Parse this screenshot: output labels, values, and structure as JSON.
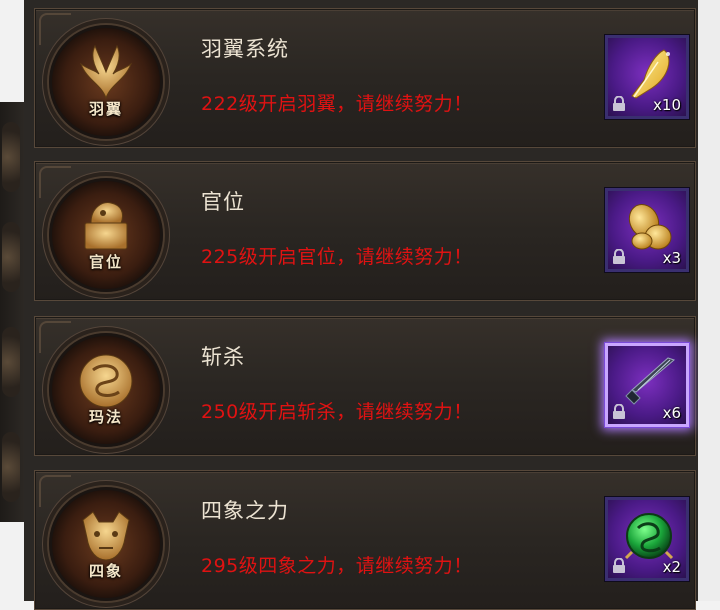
{
  "features": [
    {
      "title": "羽翼系统",
      "requirement": "222级开启羽翼，请继续努力！",
      "emblem_label": "羽翼",
      "emblem_icon": "wings-icon",
      "reward": {
        "icon": "golden-feather-icon",
        "count": "x10",
        "locked": true
      }
    },
    {
      "title": "官位",
      "requirement": "225级开启官位，请继续努力！",
      "emblem_label": "官位",
      "emblem_icon": "seal-icon",
      "reward": {
        "icon": "gold-coins-icon",
        "count": "x3",
        "locked": true
      }
    },
    {
      "title": "斩杀",
      "requirement": "250级开启斩杀，请继续努力！",
      "emblem_label": "玛法",
      "emblem_icon": "dragon-orb-icon",
      "reward": {
        "icon": "dark-blade-icon",
        "count": "x6",
        "locked": true,
        "highlighted": true
      }
    },
    {
      "title": "四象之力",
      "requirement": "295级四象之力，请继续努力！",
      "emblem_label": "四象",
      "emblem_icon": "beast-head-icon",
      "reward": {
        "icon": "jade-dragon-orb-icon",
        "count": "x2",
        "locked": true
      }
    }
  ],
  "colors": {
    "requirement_text": "#e01212",
    "title_text": "#ece3d2",
    "emblem_gold": "#d9a957"
  }
}
